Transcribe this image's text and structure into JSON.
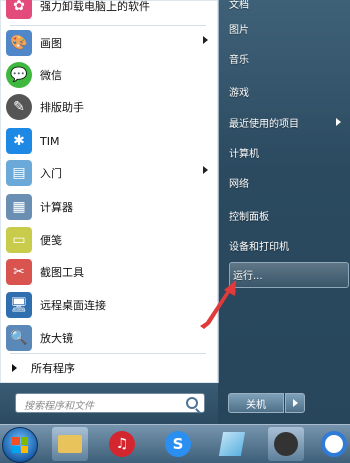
{
  "left_items": [
    {
      "label": "强力卸载电脑上的软件",
      "icon": "uninstall-icon",
      "color": "#e34b7a",
      "has_submenu": false
    },
    {
      "label": "画图",
      "icon": "paint-icon",
      "color": "#4f87c9",
      "has_submenu": true
    },
    {
      "label": "微信",
      "icon": "wechat-icon",
      "color": "#3fb83f",
      "has_submenu": false
    },
    {
      "label": "排版助手",
      "icon": "typesetting-icon",
      "color": "#555555",
      "has_submenu": false
    },
    {
      "label": "TIM",
      "icon": "tim-icon",
      "color": "#1e88e5",
      "has_submenu": false
    },
    {
      "label": "入门",
      "icon": "getting-started-icon",
      "color": "#6aa9d8",
      "has_submenu": true
    },
    {
      "label": "计算器",
      "icon": "calculator-icon",
      "color": "#6b8fb3",
      "has_submenu": false
    },
    {
      "label": "便笺",
      "icon": "sticky-notes-icon",
      "color": "#c8cc4a",
      "has_submenu": false
    },
    {
      "label": "截图工具",
      "icon": "snipping-tool-icon",
      "color": "#d9534f",
      "has_submenu": false
    },
    {
      "label": "远程桌面连接",
      "icon": "remote-desktop-icon",
      "color": "#2f6fb0",
      "has_submenu": false
    },
    {
      "label": "放大镜",
      "icon": "magnifier-icon",
      "color": "#5a88b8",
      "has_submenu": false
    }
  ],
  "all_programs_label": "所有程序",
  "search": {
    "placeholder": "搜索程序和文件"
  },
  "right_items": [
    {
      "label": "文档",
      "has_submenu": false
    },
    {
      "label": "图片",
      "has_submenu": false
    },
    {
      "label": "音乐",
      "has_submenu": false
    },
    {
      "label": "游戏",
      "has_submenu": false
    },
    {
      "label": "最近使用的项目",
      "has_submenu": true
    },
    {
      "label": "计算机",
      "has_submenu": false
    },
    {
      "label": "网络",
      "has_submenu": false
    },
    {
      "label": "控制面板",
      "has_submenu": false
    },
    {
      "label": "设备和打印机",
      "has_submenu": false
    },
    {
      "label": "运行...",
      "has_submenu": false,
      "highlighted": true
    }
  ],
  "shutdown_label": "关机",
  "taskbar_items": [
    {
      "icon": "windows-start-orb-icon"
    },
    {
      "icon": "file-explorer-icon",
      "color": "#e8c25a"
    },
    {
      "icon": "netease-music-icon",
      "color": "#d3262e"
    },
    {
      "icon": "sogou-icon",
      "color": "#2a8ff0"
    },
    {
      "icon": "document-app-icon",
      "color": "#5bb0e0"
    },
    {
      "icon": "media-player-icon",
      "color": "#333333"
    },
    {
      "icon": "chrome-icon",
      "color": "#2f7bd6"
    }
  ],
  "annotation": {
    "color": "#e03a3a"
  }
}
